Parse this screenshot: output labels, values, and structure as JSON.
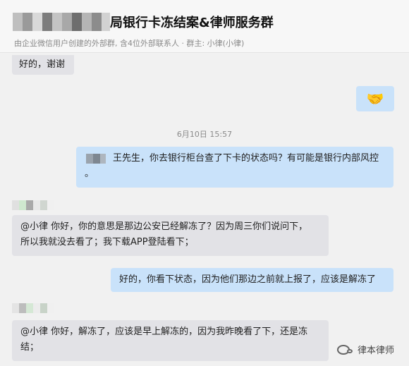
{
  "header": {
    "title": "局银行卡冻结案&律师服务群",
    "subtitle": "由企业微信用户创建的外部群, 含4位外部联系人 · 群主: 小律(小律)"
  },
  "messages": [
    {
      "id": "m1",
      "side": "left",
      "text": "好的，谢谢"
    },
    {
      "id": "m2",
      "side": "right",
      "emoji": "🤝"
    },
    {
      "id": "ts",
      "timestamp": "6月10日 15:57"
    },
    {
      "id": "m3",
      "side": "right",
      "text": "王先生，你去银行柜台查了下卡的状态吗？有可能是银行内部风控",
      "text_line2": "。"
    },
    {
      "id": "m4",
      "side": "left",
      "text": "@小律 你好，你的意思是那边公安已经解冻了？因为周三你们说问下，",
      "text_line2": "所以我就没去看了；我下载APP登陆看下；"
    },
    {
      "id": "m5",
      "side": "right",
      "text": "好的，你看下状态，因为他们那边之前就上报了，应该是解冻了"
    },
    {
      "id": "m6",
      "side": "left",
      "text": "@小律 你好，解冻了，应该是早上解冻的，因为我昨晚看了下，还是冻",
      "text_line2": "结；"
    }
  ],
  "watermark": {
    "label": "律本律师"
  }
}
